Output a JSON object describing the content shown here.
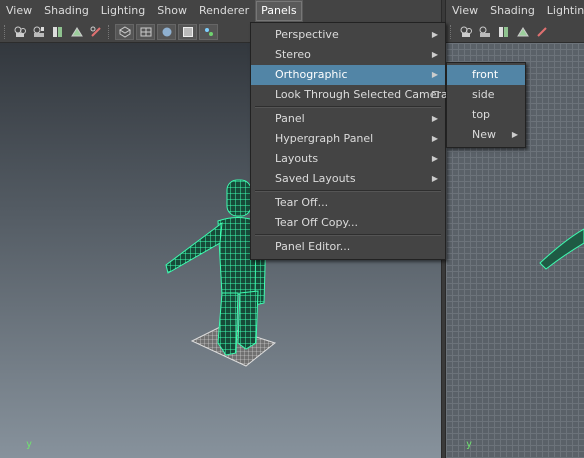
{
  "left_pane": {
    "menubar": [
      "View",
      "Shading",
      "Lighting",
      "Show",
      "Renderer",
      "Panels"
    ],
    "active_menu_index": 5,
    "axis_label": "y"
  },
  "right_pane": {
    "menubar": [
      "View",
      "Shading",
      "Lighting"
    ],
    "axis_label": "y"
  },
  "panels_menu": {
    "items": [
      {
        "label": "Perspective",
        "submenu": true
      },
      {
        "label": "Stereo",
        "submenu": true
      },
      {
        "label": "Orthographic",
        "submenu": true,
        "highlighted": true
      },
      {
        "label": "Look Through Selected Camera",
        "option_box": true
      },
      {
        "separator": true
      },
      {
        "label": "Panel",
        "submenu": true
      },
      {
        "label": "Hypergraph Panel",
        "submenu": true
      },
      {
        "label": "Layouts",
        "submenu": true
      },
      {
        "label": "Saved Layouts",
        "submenu": true
      },
      {
        "separator": true
      },
      {
        "label": "Tear Off..."
      },
      {
        "label": "Tear Off Copy..."
      },
      {
        "separator": true
      },
      {
        "label": "Panel Editor..."
      }
    ]
  },
  "orthographic_submenu": {
    "items": [
      {
        "label": "front",
        "highlighted": true
      },
      {
        "label": "side"
      },
      {
        "label": "top"
      },
      {
        "label": "New",
        "submenu": true
      }
    ]
  },
  "colors": {
    "menu_bg": "#444444",
    "highlight": "#5285a6",
    "wireframe": "#33e8a0",
    "axis": "#6fe36f"
  }
}
